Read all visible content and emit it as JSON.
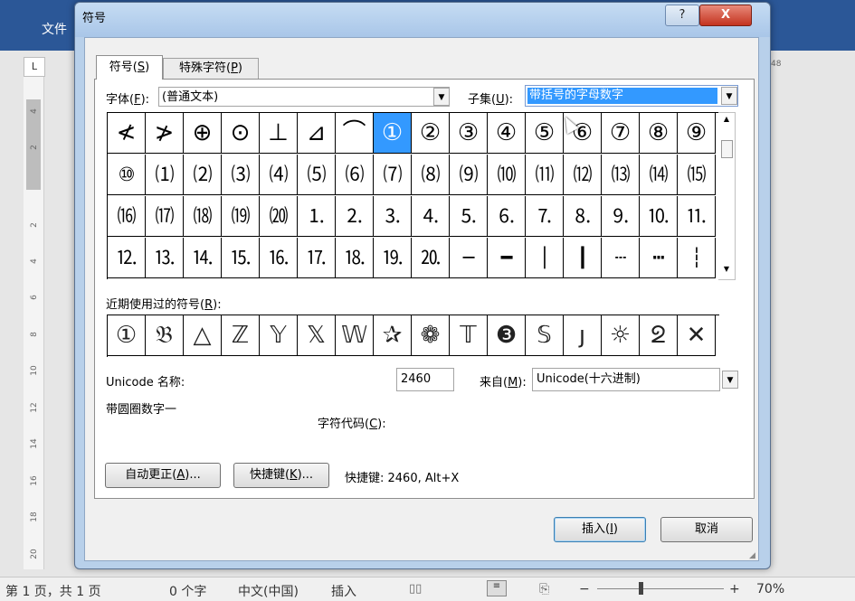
{
  "word": {
    "file_tab": "文件",
    "ruler_corner": "L",
    "ruler_numbers": [
      "4",
      "2",
      "2",
      "4",
      "6",
      "8",
      "10",
      "12",
      "14",
      "16",
      "18",
      "20"
    ],
    "right_number": "48",
    "status": {
      "page": "第 1 页，共 1 页",
      "words": "0 个字",
      "language": "中文(中国)",
      "mode": "插入",
      "zoom": "70%",
      "zoom_minus": "−",
      "zoom_plus": "+"
    }
  },
  "dialog": {
    "title": "符号",
    "help_label": "?",
    "close_label": "X",
    "tabs": {
      "symbols": {
        "text": "符号(",
        "key": "S",
        "tail": ")"
      },
      "special": {
        "text": "特殊字符(",
        "key": "P",
        "tail": ")"
      }
    },
    "font": {
      "label_text": "字体(",
      "label_key": "F",
      "label_tail": "):",
      "value": "(普通文本)"
    },
    "subset": {
      "label_text": "子集(",
      "label_key": "U",
      "label_tail": "):",
      "value": "带括号的字母数字"
    },
    "grid_rows": [
      [
        "≮",
        "≯",
        "⊕",
        "⊙",
        "⊥",
        "⊿",
        "⌒",
        "①",
        "②",
        "③",
        "④",
        "⑤",
        "⑥",
        "⑦",
        "⑧",
        "⑨"
      ],
      [
        "⑩",
        "⑴",
        "⑵",
        "⑶",
        "⑷",
        "⑸",
        "⑹",
        "⑺",
        "⑻",
        "⑼",
        "⑽",
        "⑾",
        "⑿",
        "⒀",
        "⒁",
        "⒂"
      ],
      [
        "⒃",
        "⒄",
        "⒅",
        "⒆",
        "⒇",
        "⒈",
        "⒉",
        "⒊",
        "⒋",
        "⒌",
        "⒍",
        "⒎",
        "⒏",
        "⒐",
        "⒑",
        "⒒"
      ],
      [
        "⒓",
        "⒔",
        "⒕",
        "⒖",
        "⒗",
        "⒘",
        "⒙",
        "⒚",
        "⒛",
        "─",
        "━",
        "│",
        "┃",
        "┄",
        "┅",
        "┆"
      ]
    ],
    "selected_index": 7,
    "recent": {
      "label_text": "近期使用过的符号(",
      "label_key": "R",
      "label_tail": "):",
      "symbols": [
        "①",
        "𝔅",
        "△",
        "ℤ",
        "𝕐",
        "𝕏",
        "𝕎",
        "✰",
        "❁",
        "𝕋",
        "❸",
        "𝕊",
        "ȷ",
        "☼",
        "ᘖ",
        "✕"
      ]
    },
    "unicode_name_label": "Unicode 名称:",
    "unicode_name_value": "带圆圈数字一",
    "code": {
      "label_text": "字符代码(",
      "label_key": "C",
      "label_tail": "):",
      "value": "2460"
    },
    "from": {
      "label_text": "来自(",
      "label_key": "M",
      "label_tail": "):",
      "value": "Unicode(十六进制)"
    },
    "autocorrect_btn": {
      "text": "自动更正(",
      "key": "A",
      "tail": ")..."
    },
    "shortcut_btn": {
      "text": "快捷键(",
      "key": "K",
      "tail": ")..."
    },
    "shortcut_text": "快捷键: 2460, Alt+X",
    "insert_btn": {
      "text": "插入(",
      "key": "I",
      "tail": ")"
    },
    "cancel_btn": "取消"
  }
}
